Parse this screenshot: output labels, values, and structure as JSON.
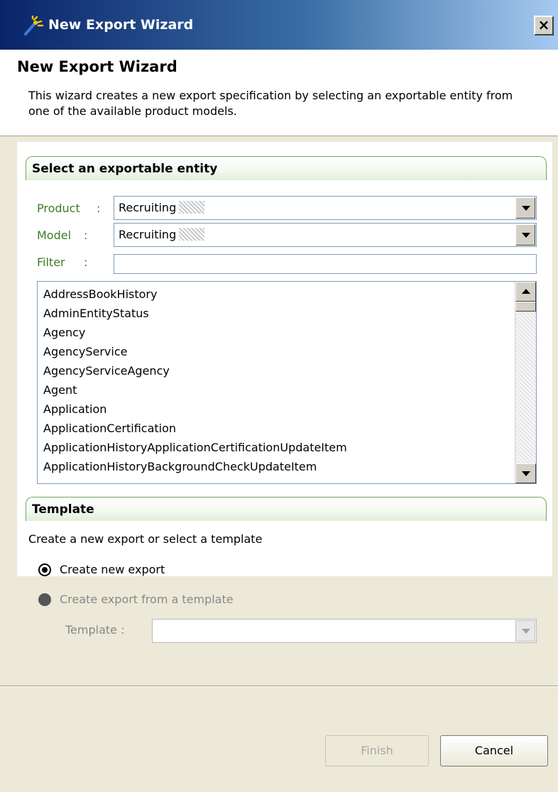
{
  "window": {
    "title": "New Export Wizard",
    "close_label": "×"
  },
  "header": {
    "title": "New Export Wizard",
    "description": "This wizard creates a new export specification by selecting an exportable entity from one of the available product models."
  },
  "entity_section": {
    "title": "Select an exportable entity",
    "product_label": "Product",
    "model_label": "Model",
    "filter_label": "Filter",
    "colon": ":",
    "product_value": "Recruiting",
    "model_value": "Recruiting",
    "filter_value": "",
    "entities": [
      "AddressBookHistory",
      "AdminEntityStatus",
      "Agency",
      "AgencyService",
      "AgencyServiceAgency",
      "Agent",
      "Application",
      "ApplicationCertification",
      "ApplicationHistoryApplicationCertificationUpdateItem",
      "ApplicationHistoryBackgroundCheckUpdateItem"
    ]
  },
  "template_section": {
    "title": "Template",
    "description": "Create a new export or select a template",
    "option_new": "Create new export",
    "option_template": "Create export from a template",
    "template_label": "Template :",
    "template_value": "",
    "selected": "new"
  },
  "buttons": {
    "finish": "Finish",
    "cancel": "Cancel"
  },
  "colors": {
    "title_gradient_start": "#0a246a",
    "title_gradient_end": "#a6caf0",
    "section_border": "#73a563",
    "field_label": "#3b7d23"
  }
}
